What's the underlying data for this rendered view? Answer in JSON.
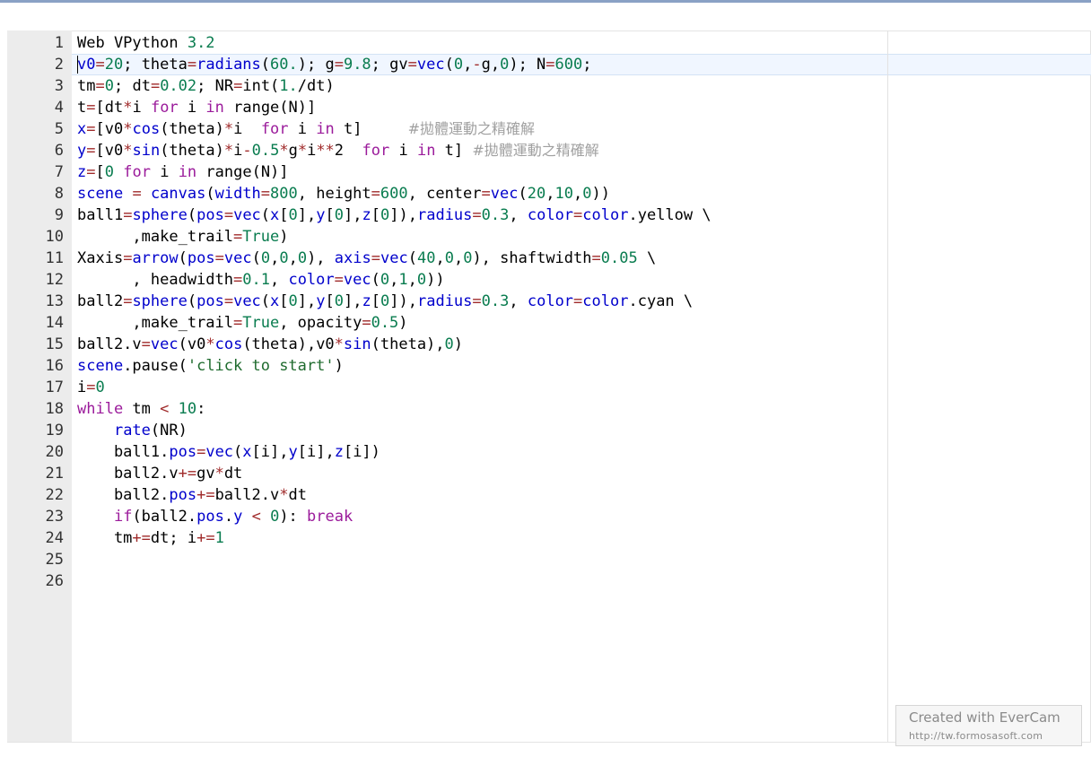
{
  "editor": {
    "lines": [
      {
        "n": "1",
        "tokens": [
          [
            "Web VPython ",
            ""
          ],
          [
            "3.2",
            "num"
          ]
        ]
      },
      {
        "n": "2",
        "tokens": [
          [
            "v0",
            "fn"
          ],
          [
            "=",
            "op"
          ],
          [
            "20",
            "num"
          ],
          [
            "; theta",
            ""
          ],
          [
            "=",
            "op"
          ],
          [
            "radians",
            "fn"
          ],
          [
            "(",
            ""
          ],
          [
            "60.",
            "num"
          ],
          [
            "); g",
            ""
          ],
          [
            "=",
            "op"
          ],
          [
            "9.8",
            "num"
          ],
          [
            "; gv",
            ""
          ],
          [
            "=",
            "op"
          ],
          [
            "vec",
            "fn"
          ],
          [
            "(",
            ""
          ],
          [
            "0",
            "num"
          ],
          [
            ",",
            ""
          ],
          [
            "-",
            "op"
          ],
          [
            "g,",
            ""
          ],
          [
            "0",
            "num"
          ],
          [
            "); N",
            ""
          ],
          [
            "=",
            "op"
          ],
          [
            "600",
            "num"
          ],
          [
            ";",
            ""
          ]
        ]
      },
      {
        "n": "3",
        "tokens": [
          [
            "tm",
            ""
          ],
          [
            "=",
            "op"
          ],
          [
            "0",
            "num"
          ],
          [
            "; dt",
            ""
          ],
          [
            "=",
            "op"
          ],
          [
            "0.02",
            "num"
          ],
          [
            "; NR",
            ""
          ],
          [
            "=",
            "op"
          ],
          [
            "int(",
            ""
          ],
          [
            "1.",
            "num"
          ],
          [
            "/dt)",
            ""
          ]
        ]
      },
      {
        "n": "4",
        "tokens": [
          [
            "t",
            ""
          ],
          [
            "=",
            "op"
          ],
          [
            "[dt",
            ""
          ],
          [
            "*",
            "op"
          ],
          [
            "i ",
            ""
          ],
          [
            "for",
            "kw"
          ],
          [
            " i ",
            ""
          ],
          [
            "in",
            "kw"
          ],
          [
            " range(N)]",
            ""
          ]
        ]
      },
      {
        "n": "5",
        "tokens": [
          [
            "x",
            "fn"
          ],
          [
            "=",
            "op"
          ],
          [
            "[v0",
            ""
          ],
          [
            "*",
            "op"
          ],
          [
            "cos",
            "fn"
          ],
          [
            "(theta)",
            ""
          ],
          [
            "*",
            "op"
          ],
          [
            "i  ",
            ""
          ],
          [
            "for",
            "kw"
          ],
          [
            " i ",
            ""
          ],
          [
            "in",
            "kw"
          ],
          [
            " t]     ",
            ""
          ],
          [
            "#拋體運動之精確解",
            "cmt"
          ]
        ]
      },
      {
        "n": "6",
        "tokens": [
          [
            "y",
            "fn"
          ],
          [
            "=",
            "op"
          ],
          [
            "[v0",
            ""
          ],
          [
            "*",
            "op"
          ],
          [
            "sin",
            "fn"
          ],
          [
            "(theta)",
            ""
          ],
          [
            "*",
            "op"
          ],
          [
            "i",
            ""
          ],
          [
            "-",
            "op"
          ],
          [
            "0.5",
            "num"
          ],
          [
            "*",
            "op"
          ],
          [
            "g",
            ""
          ],
          [
            "*",
            "op"
          ],
          [
            "i",
            ""
          ],
          [
            "**",
            "op"
          ],
          [
            "2  ",
            ""
          ],
          [
            "for",
            "kw"
          ],
          [
            " i ",
            ""
          ],
          [
            "in",
            "kw"
          ],
          [
            " t] ",
            ""
          ],
          [
            "#拋體運動之精確解",
            "cmt"
          ]
        ]
      },
      {
        "n": "7",
        "tokens": [
          [
            "z",
            "fn"
          ],
          [
            "=",
            "op"
          ],
          [
            "[",
            ""
          ],
          [
            "0",
            "num"
          ],
          [
            " ",
            ""
          ],
          [
            "for",
            "kw"
          ],
          [
            " i ",
            ""
          ],
          [
            "in",
            "kw"
          ],
          [
            " range(N)]",
            ""
          ]
        ]
      },
      {
        "n": "8",
        "tokens": [
          [
            "scene",
            "fn"
          ],
          [
            " ",
            ""
          ],
          [
            "=",
            "op"
          ],
          [
            " ",
            ""
          ],
          [
            "canvas",
            "fn"
          ],
          [
            "(",
            ""
          ],
          [
            "width",
            "fn"
          ],
          [
            "=",
            "op"
          ],
          [
            "800",
            "num"
          ],
          [
            ", height",
            ""
          ],
          [
            "=",
            "op"
          ],
          [
            "600",
            "num"
          ],
          [
            ", center",
            ""
          ],
          [
            "=",
            "op"
          ],
          [
            "vec",
            "fn"
          ],
          [
            "(",
            ""
          ],
          [
            "20",
            "num"
          ],
          [
            ",",
            ""
          ],
          [
            "10",
            "num"
          ],
          [
            ",",
            ""
          ],
          [
            "0",
            "num"
          ],
          [
            "))",
            ""
          ]
        ]
      },
      {
        "n": "9",
        "tokens": [
          [
            "ball1",
            ""
          ],
          [
            "=",
            "op"
          ],
          [
            "sphere",
            "fn"
          ],
          [
            "(",
            ""
          ],
          [
            "pos",
            "fn"
          ],
          [
            "=",
            "op"
          ],
          [
            "vec",
            "fn"
          ],
          [
            "(",
            ""
          ],
          [
            "x",
            "fn"
          ],
          [
            "[",
            ""
          ],
          [
            "0",
            "num"
          ],
          [
            "],",
            ""
          ],
          [
            "y",
            "fn"
          ],
          [
            "[",
            ""
          ],
          [
            "0",
            "num"
          ],
          [
            "],",
            ""
          ],
          [
            "z",
            "fn"
          ],
          [
            "[",
            ""
          ],
          [
            "0",
            "num"
          ],
          [
            "]),",
            ""
          ],
          [
            "radius",
            "fn"
          ],
          [
            "=",
            "op"
          ],
          [
            "0.3",
            "num"
          ],
          [
            ", ",
            ""
          ],
          [
            "color",
            "fn"
          ],
          [
            "=",
            "op"
          ],
          [
            "color",
            "fn"
          ],
          [
            ".yellow \\",
            ""
          ]
        ]
      },
      {
        "n": "10",
        "tokens": [
          [
            "      ,make_trail",
            ""
          ],
          [
            "=",
            "op"
          ],
          [
            "True",
            "num"
          ],
          [
            ")",
            ""
          ]
        ]
      },
      {
        "n": "11",
        "tokens": [
          [
            "Xaxis",
            ""
          ],
          [
            "=",
            "op"
          ],
          [
            "arrow",
            "fn"
          ],
          [
            "(",
            ""
          ],
          [
            "pos",
            "fn"
          ],
          [
            "=",
            "op"
          ],
          [
            "vec",
            "fn"
          ],
          [
            "(",
            ""
          ],
          [
            "0",
            "num"
          ],
          [
            ",",
            ""
          ],
          [
            "0",
            "num"
          ],
          [
            ",",
            ""
          ],
          [
            "0",
            "num"
          ],
          [
            "), ",
            ""
          ],
          [
            "axis",
            "fn"
          ],
          [
            "=",
            "op"
          ],
          [
            "vec",
            "fn"
          ],
          [
            "(",
            ""
          ],
          [
            "40",
            "num"
          ],
          [
            ",",
            ""
          ],
          [
            "0",
            "num"
          ],
          [
            ",",
            ""
          ],
          [
            "0",
            "num"
          ],
          [
            "), shaftwidth",
            ""
          ],
          [
            "=",
            "op"
          ],
          [
            "0.05",
            "num"
          ],
          [
            " \\",
            ""
          ]
        ]
      },
      {
        "n": "12",
        "tokens": [
          [
            "      , headwidth",
            ""
          ],
          [
            "=",
            "op"
          ],
          [
            "0.1",
            "num"
          ],
          [
            ", ",
            ""
          ],
          [
            "color",
            "fn"
          ],
          [
            "=",
            "op"
          ],
          [
            "vec",
            "fn"
          ],
          [
            "(",
            ""
          ],
          [
            "0",
            "num"
          ],
          [
            ",",
            ""
          ],
          [
            "1",
            "num"
          ],
          [
            ",",
            ""
          ],
          [
            "0",
            "num"
          ],
          [
            "))",
            ""
          ]
        ]
      },
      {
        "n": "13",
        "tokens": [
          [
            "ball2",
            ""
          ],
          [
            "=",
            "op"
          ],
          [
            "sphere",
            "fn"
          ],
          [
            "(",
            ""
          ],
          [
            "pos",
            "fn"
          ],
          [
            "=",
            "op"
          ],
          [
            "vec",
            "fn"
          ],
          [
            "(",
            ""
          ],
          [
            "x",
            "fn"
          ],
          [
            "[",
            ""
          ],
          [
            "0",
            "num"
          ],
          [
            "],",
            ""
          ],
          [
            "y",
            "fn"
          ],
          [
            "[",
            ""
          ],
          [
            "0",
            "num"
          ],
          [
            "],",
            ""
          ],
          [
            "z",
            "fn"
          ],
          [
            "[",
            ""
          ],
          [
            "0",
            "num"
          ],
          [
            "]),",
            ""
          ],
          [
            "radius",
            "fn"
          ],
          [
            "=",
            "op"
          ],
          [
            "0.3",
            "num"
          ],
          [
            ", ",
            ""
          ],
          [
            "color",
            "fn"
          ],
          [
            "=",
            "op"
          ],
          [
            "color",
            "fn"
          ],
          [
            ".cyan \\",
            ""
          ]
        ]
      },
      {
        "n": "14",
        "tokens": [
          [
            "      ,make_trail",
            ""
          ],
          [
            "=",
            "op"
          ],
          [
            "True",
            "num"
          ],
          [
            ", opacity",
            ""
          ],
          [
            "=",
            "op"
          ],
          [
            "0.5",
            "num"
          ],
          [
            ")",
            ""
          ]
        ]
      },
      {
        "n": "15",
        "tokens": [
          [
            "ball2.v",
            ""
          ],
          [
            "=",
            "op"
          ],
          [
            "vec",
            "fn"
          ],
          [
            "(v0",
            ""
          ],
          [
            "*",
            "op"
          ],
          [
            "cos",
            "fn"
          ],
          [
            "(theta),v0",
            ""
          ],
          [
            "*",
            "op"
          ],
          [
            "sin",
            "fn"
          ],
          [
            "(theta),",
            ""
          ],
          [
            "0",
            "num"
          ],
          [
            ")",
            ""
          ]
        ]
      },
      {
        "n": "16",
        "tokens": [
          [
            "scene",
            "fn"
          ],
          [
            ".pause(",
            ""
          ],
          [
            "'click to start'",
            "str"
          ],
          [
            ")",
            ""
          ]
        ]
      },
      {
        "n": "17",
        "tokens": [
          [
            "i",
            ""
          ],
          [
            "=",
            "op"
          ],
          [
            "0",
            "num"
          ]
        ]
      },
      {
        "n": "18",
        "tokens": [
          [
            "while",
            "kw"
          ],
          [
            " tm ",
            ""
          ],
          [
            "<",
            "op"
          ],
          [
            " ",
            ""
          ],
          [
            "10",
            "num"
          ],
          [
            ":",
            ""
          ]
        ]
      },
      {
        "n": "19",
        "tokens": [
          [
            "    ",
            ""
          ],
          [
            "rate",
            "fn"
          ],
          [
            "(NR)",
            ""
          ]
        ]
      },
      {
        "n": "20",
        "tokens": [
          [
            "    ball1.",
            ""
          ],
          [
            "pos",
            "fn"
          ],
          [
            "=",
            "op"
          ],
          [
            "vec",
            "fn"
          ],
          [
            "(",
            ""
          ],
          [
            "x",
            "fn"
          ],
          [
            "[i],",
            ""
          ],
          [
            "y",
            "fn"
          ],
          [
            "[i],",
            ""
          ],
          [
            "z",
            "fn"
          ],
          [
            "[i])",
            ""
          ]
        ]
      },
      {
        "n": "21",
        "tokens": [
          [
            "    ball2.v",
            ""
          ],
          [
            "+=",
            "op"
          ],
          [
            "gv",
            ""
          ],
          [
            "*",
            "op"
          ],
          [
            "dt",
            ""
          ]
        ]
      },
      {
        "n": "22",
        "tokens": [
          [
            "    ball2.",
            ""
          ],
          [
            "pos",
            "fn"
          ],
          [
            "+=",
            "op"
          ],
          [
            "ball2.v",
            ""
          ],
          [
            "*",
            "op"
          ],
          [
            "dt",
            ""
          ]
        ]
      },
      {
        "n": "23",
        "tokens": [
          [
            "    ",
            ""
          ],
          [
            "if",
            "kw"
          ],
          [
            "(ball2.",
            ""
          ],
          [
            "pos",
            "fn"
          ],
          [
            ".",
            ""
          ],
          [
            "y",
            "fn"
          ],
          [
            " ",
            ""
          ],
          [
            "<",
            "op"
          ],
          [
            " ",
            ""
          ],
          [
            "0",
            "num"
          ],
          [
            "): ",
            ""
          ],
          [
            "break",
            "kw"
          ]
        ]
      },
      {
        "n": "24",
        "tokens": [
          [
            "    tm",
            ""
          ],
          [
            "+=",
            "op"
          ],
          [
            "dt; i",
            ""
          ],
          [
            "+=",
            "op"
          ],
          [
            "1",
            "num"
          ]
        ]
      },
      {
        "n": "25",
        "tokens": []
      },
      {
        "n": "26",
        "tokens": []
      }
    ]
  },
  "watermark": {
    "title": "Created with EverCam",
    "url": "http://tw.formosasoft.com"
  }
}
